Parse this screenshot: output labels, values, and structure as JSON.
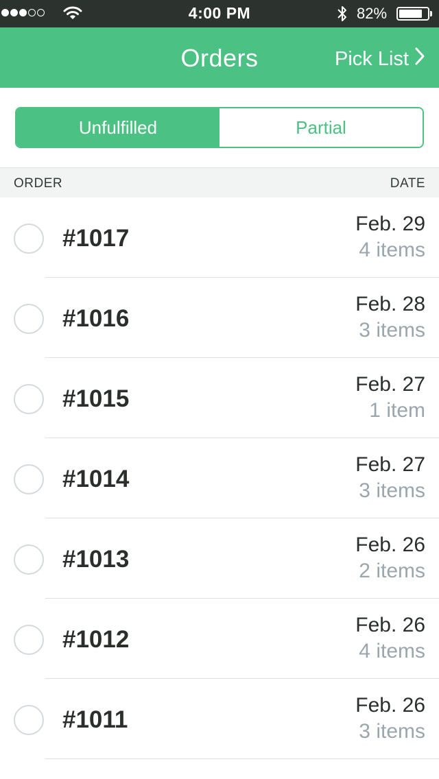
{
  "status_bar": {
    "time": "4:00 PM",
    "battery_percent": "82%",
    "battery_level": 0.82,
    "signal_bars_filled": 3,
    "signal_bars_total": 5
  },
  "nav": {
    "title": "Orders",
    "pick_list_label": "Pick List"
  },
  "segments": {
    "unfulfilled": "Unfulfilled",
    "partial": "Partial",
    "selected": "Unfulfilled"
  },
  "columns": {
    "order": "ORDER",
    "date": "DATE"
  },
  "orders": [
    {
      "number": "#1017",
      "date": "Feb. 29",
      "items": "4 items"
    },
    {
      "number": "#1016",
      "date": "Feb. 28",
      "items": "3 items"
    },
    {
      "number": "#1015",
      "date": "Feb. 27",
      "items": "1 item"
    },
    {
      "number": "#1014",
      "date": "Feb. 27",
      "items": "3 items"
    },
    {
      "number": "#1013",
      "date": "Feb. 26",
      "items": "2 items"
    },
    {
      "number": "#1012",
      "date": "Feb. 26",
      "items": "4 items"
    },
    {
      "number": "#1011",
      "date": "Feb. 26",
      "items": "3 items"
    }
  ],
  "colors": {
    "accent": "#4bc183",
    "status_bar": "#2c332f",
    "muted_text": "#9aa6ae",
    "header_bg": "#f2f3f3"
  }
}
